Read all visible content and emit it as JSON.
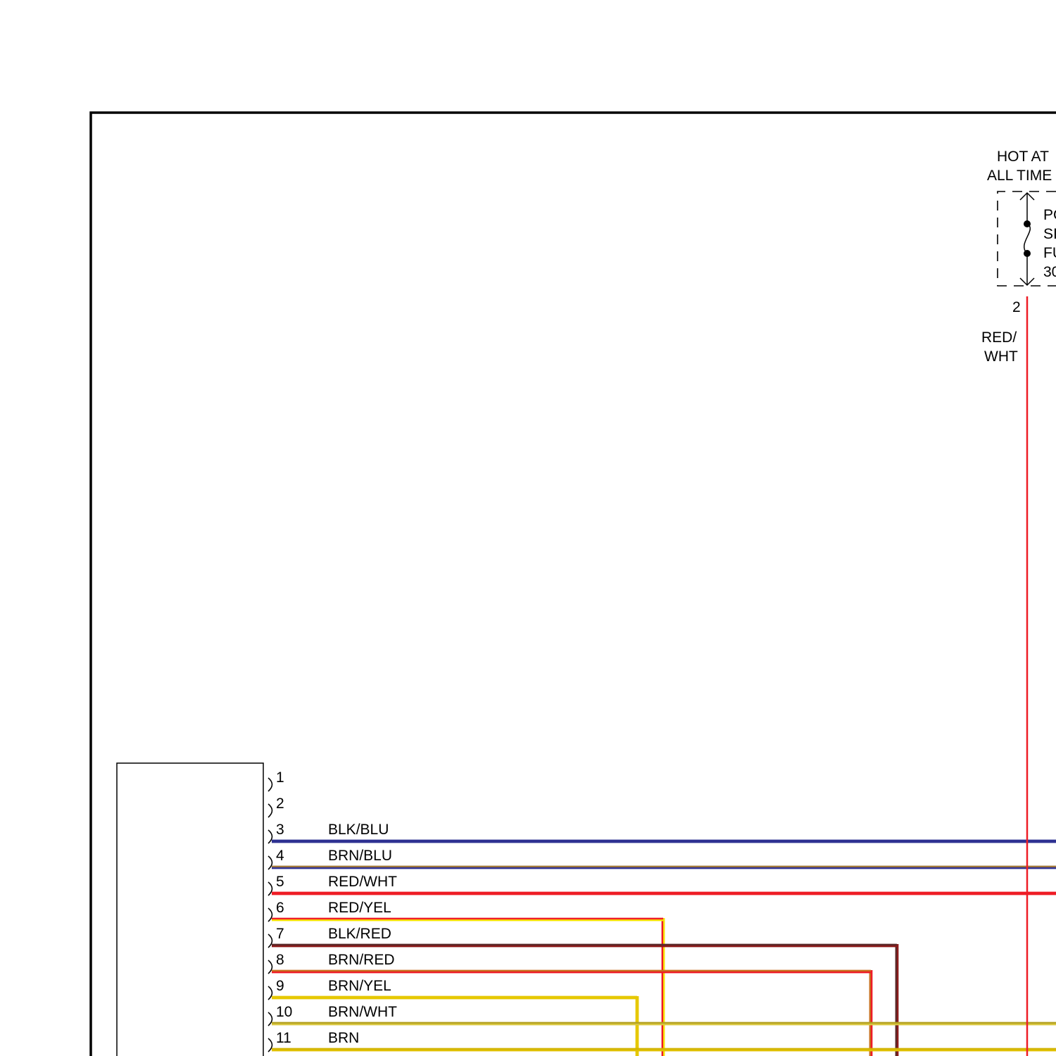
{
  "diagram": {
    "power": {
      "hot_label_line1": "HOT AT",
      "hot_label_line2": "ALL TIME",
      "fuse_label_lines": [
        "PC",
        "SI",
        "FU",
        "30"
      ],
      "terminal": "2",
      "wire_color_line1": "RED/",
      "wire_color_line2": "WHT",
      "wire_hex": "#ee1c25"
    },
    "connector_pins": [
      {
        "pin": "1",
        "wire": "",
        "colors": []
      },
      {
        "pin": "2",
        "wire": "",
        "colors": []
      },
      {
        "pin": "3",
        "wire": "BLK/BLU",
        "colors": [
          "#2e3192",
          "#2e3192"
        ]
      },
      {
        "pin": "4",
        "wire": "BRN/BLU",
        "colors": [
          "#a0783c",
          "#2e3192"
        ]
      },
      {
        "pin": "5",
        "wire": "RED/WHT",
        "colors": [
          "#ee1c25",
          "#ee1c25"
        ]
      },
      {
        "pin": "6",
        "wire": "RED/YEL",
        "colors": [
          "#ee1c25",
          "#f7e000"
        ]
      },
      {
        "pin": "7",
        "wire": "BLK/RED",
        "colors": [
          "#5a2828",
          "#8b1a1a"
        ]
      },
      {
        "pin": "8",
        "wire": "BRN/RED",
        "colors": [
          "#c96e1e",
          "#ee1c25"
        ]
      },
      {
        "pin": "9",
        "wire": "BRN/YEL",
        "colors": [
          "#e6c800",
          "#e6c800"
        ]
      },
      {
        "pin": "10",
        "wire": "BRN/WHT",
        "colors": [
          "#b4a020",
          "#d8c640"
        ]
      },
      {
        "pin": "11",
        "wire": "BRN",
        "colors": [
          "#d2b400",
          "#e0c000"
        ]
      }
    ]
  }
}
